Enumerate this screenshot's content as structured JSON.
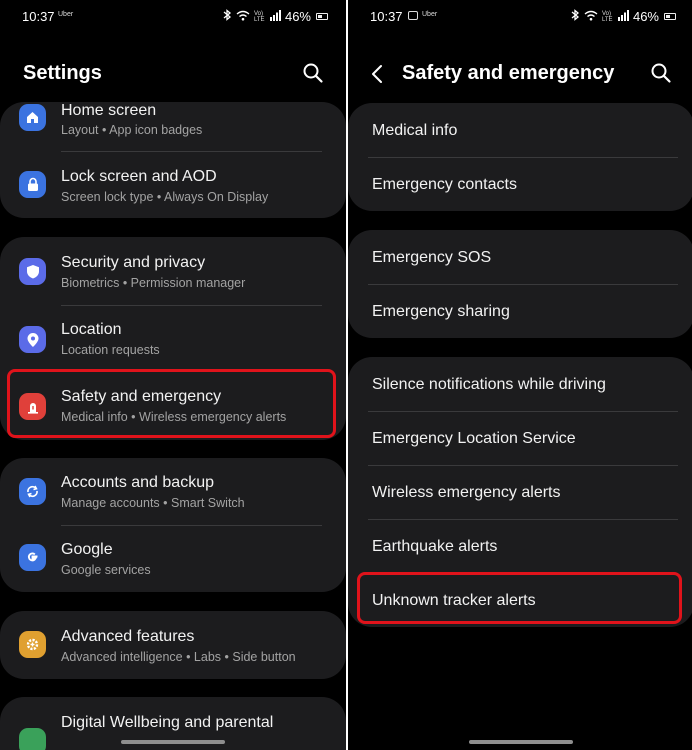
{
  "status_bar": {
    "time": "10:37",
    "carrier_icon": "Uber",
    "network": "Vo) LTE",
    "battery": "46%"
  },
  "left": {
    "title": "Settings",
    "items": [
      {
        "title": "Home screen",
        "subtitle": "Layout  •  App icon badges",
        "icon": "home-icon",
        "color": "#3b73e0"
      },
      {
        "title": "Lock screen and AOD",
        "subtitle": "Screen lock type  •  Always On Display",
        "icon": "lock-icon",
        "color": "#3b73e0"
      },
      {
        "title": "Security and privacy",
        "subtitle": "Biometrics  •  Permission manager",
        "icon": "shield-icon",
        "color": "#5b6be8"
      },
      {
        "title": "Location",
        "subtitle": "Location requests",
        "icon": "location-icon",
        "color": "#5b6be8"
      },
      {
        "title": "Safety and emergency",
        "subtitle": "Medical info  •  Wireless emergency alerts",
        "icon": "emergency-icon",
        "color": "#e0403a"
      },
      {
        "title": "Accounts and backup",
        "subtitle": "Manage accounts  •  Smart Switch",
        "icon": "sync-icon",
        "color": "#3b73e0"
      },
      {
        "title": "Google",
        "subtitle": "Google services",
        "icon": "google-icon",
        "color": "#3b73e0"
      },
      {
        "title": "Advanced features",
        "subtitle": "Advanced intelligence  •  Labs  •  Side button",
        "icon": "gear-plus-icon",
        "color": "#e0a030"
      },
      {
        "title": "Digital Wellbeing and parental",
        "subtitle": "",
        "icon": "wellbeing-icon",
        "color": "#3aa15a"
      }
    ]
  },
  "right": {
    "title": "Safety and emergency",
    "items": [
      "Medical info",
      "Emergency contacts",
      "Emergency SOS",
      "Emergency sharing",
      "Silence notifications while driving",
      "Emergency Location Service",
      "Wireless emergency alerts",
      "Earthquake alerts",
      "Unknown tracker alerts"
    ]
  },
  "colors": {
    "highlight": "#e0131b",
    "card": "#1c1c1e",
    "background": "#000000"
  }
}
